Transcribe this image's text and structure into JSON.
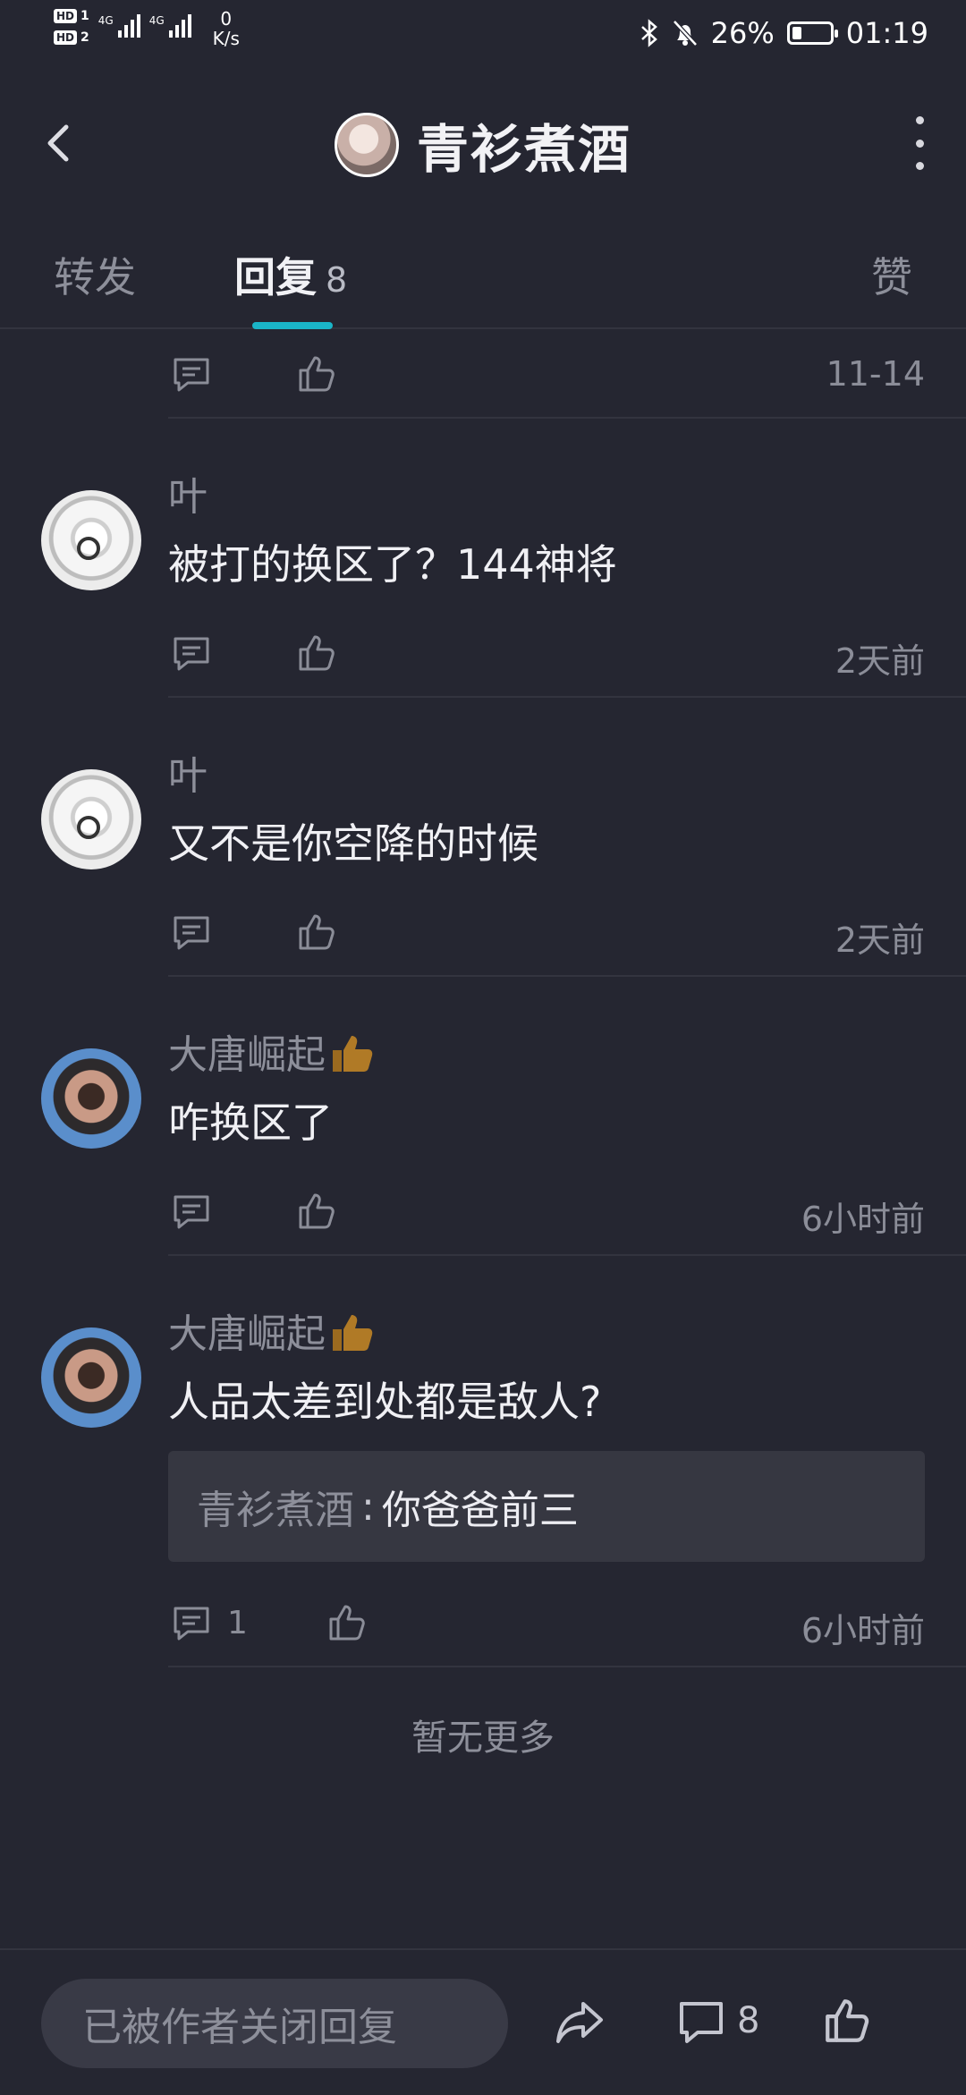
{
  "status_bar": {
    "hd1": "HD",
    "sim1": "1",
    "hd2": "HD",
    "sim2": "2",
    "net1": "4G",
    "net2": "4G",
    "speed_value": "0",
    "speed_unit": "K/s",
    "battery_pct": "26%",
    "battery_level": 0.26,
    "time": "01:19"
  },
  "header": {
    "title": "青衫煮酒"
  },
  "tabs": {
    "forward": "转发",
    "reply": "回复",
    "reply_count": "8",
    "like": "赞",
    "active": "reply"
  },
  "top_row": {
    "time": "11-14"
  },
  "comments": [
    {
      "name": "叶",
      "text": "被打的换区了？144神将",
      "time": "2天前",
      "avatar": "sketch-avatar"
    },
    {
      "name": "叶",
      "text": "又不是你空降的时候",
      "time": "2天前",
      "avatar": "sketch-avatar"
    },
    {
      "name": "大唐崛起",
      "text": "咋换区了",
      "time": "6小时前",
      "avatar": "photo-avatar",
      "emoji": "thumbs-up-emoji"
    },
    {
      "name": "大唐崛起",
      "text": "人品太差到处都是敌人?",
      "time": "6小时前",
      "avatar": "photo-avatar",
      "emoji": "thumbs-up-emoji",
      "quote": {
        "name": "青衫煮酒",
        "sep": ":",
        "text": "你爸爸前三"
      },
      "reply_count": "1"
    }
  ],
  "footer": {
    "no_more": "暂无更多"
  },
  "bottom_bar": {
    "input_placeholder": "已被作者关闭回复",
    "comment_count": "8"
  },
  "colors": {
    "background": "#252631",
    "accent": "#1ab5c8",
    "muted": "#8d8f9a"
  }
}
